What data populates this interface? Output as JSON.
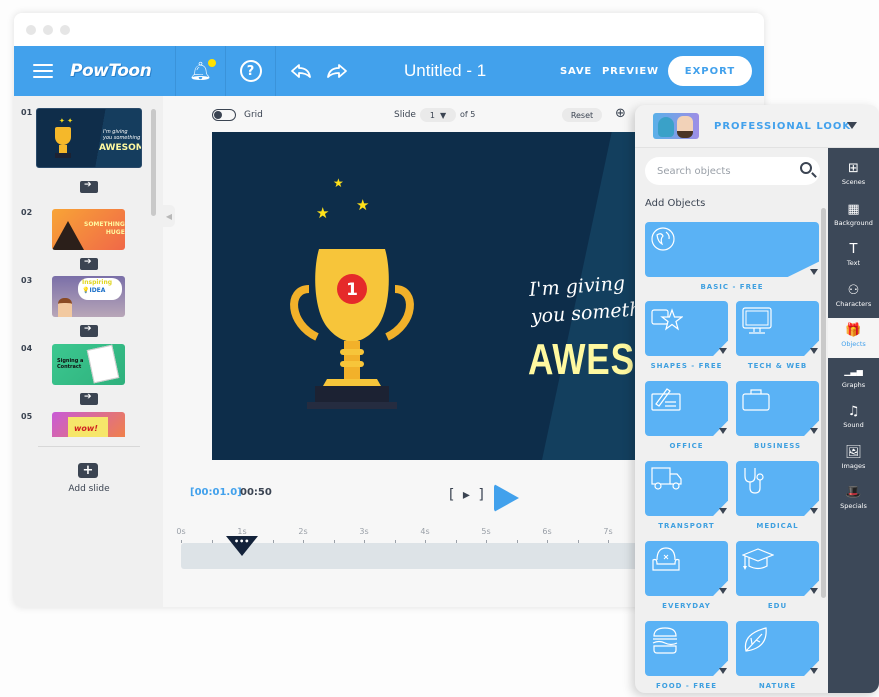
{
  "header": {
    "logo": "PowToon",
    "document_title": "Untitled - 1",
    "save_label": "SAVE",
    "preview_label": "PREVIEW",
    "export_label": "EXPORT",
    "notification_badge_color": "#ffe100"
  },
  "toolbar": {
    "grid_label": "Grid",
    "grid_enabled": false,
    "slide_label": "Slide",
    "slide_current": "1",
    "slide_of": "of 5",
    "reset_label": "Reset"
  },
  "slides": {
    "items": [
      {
        "number": "01",
        "title": "I'm giving you something AWESOME!"
      },
      {
        "number": "02",
        "title": "SOMETHING HUGE"
      },
      {
        "number": "03",
        "title": "Inspiring IDEA"
      },
      {
        "number": "04",
        "title": "Signing a Contract"
      },
      {
        "number": "05",
        "title": "wow!"
      }
    ],
    "add_slide_label": "Add slide"
  },
  "canvas": {
    "caption_line1": "I'm giving",
    "caption_line2": "you someth",
    "headline": "AWESO",
    "trophy_badge": "1",
    "background_color": "#0d2d4a"
  },
  "player": {
    "current_time": "[00:01.0]",
    "total_time": "00:50",
    "timeline_ticks": [
      "0s",
      "1s",
      "2s",
      "3s",
      "4s",
      "5s",
      "6s",
      "7s"
    ],
    "playhead_seconds": 1.0
  },
  "object_panel": {
    "style_title": "PROFESSIONAL LOOK",
    "search_placeholder": "Search objects",
    "section_title": "Add Objects",
    "categories": [
      {
        "label": "BASIC - FREE",
        "icon": "globe-icon"
      },
      {
        "label": "SHAPES - FREE",
        "icon": "shapes-icon"
      },
      {
        "label": "TECH & WEB",
        "icon": "monitor-icon"
      },
      {
        "label": "OFFICE",
        "icon": "check-pen-icon"
      },
      {
        "label": "BUSINESS",
        "icon": "briefcase-icon"
      },
      {
        "label": "TRANSPORT",
        "icon": "truck-icon"
      },
      {
        "label": "MEDICAL",
        "icon": "stethoscope-icon"
      },
      {
        "label": "EVERYDAY",
        "icon": "armchair-icon"
      },
      {
        "label": "EDU",
        "icon": "graduation-cap-icon"
      },
      {
        "label": "FOOD - FREE",
        "icon": "burger-icon"
      },
      {
        "label": "NATURE",
        "icon": "leaf-icon"
      }
    ]
  },
  "sidebar": {
    "items": [
      {
        "label": "Scenes",
        "icon": "⊞",
        "active": false
      },
      {
        "label": "Background",
        "icon": "▦",
        "active": false
      },
      {
        "label": "Text",
        "icon": "T",
        "active": false
      },
      {
        "label": "Characters",
        "icon": "⚇",
        "active": false
      },
      {
        "label": "Objects",
        "icon": "🎁",
        "active": true
      },
      {
        "label": "Graphs",
        "icon": "▁▃▅",
        "active": false
      },
      {
        "label": "Sound",
        "icon": "♫",
        "active": false
      },
      {
        "label": "Images",
        "icon": "🖼",
        "active": false
      },
      {
        "label": "Specials",
        "icon": "🎩",
        "active": false
      }
    ]
  },
  "colors": {
    "accent": "#42a1ec",
    "tile": "#5ab2f5",
    "dark": "#3c4858"
  }
}
